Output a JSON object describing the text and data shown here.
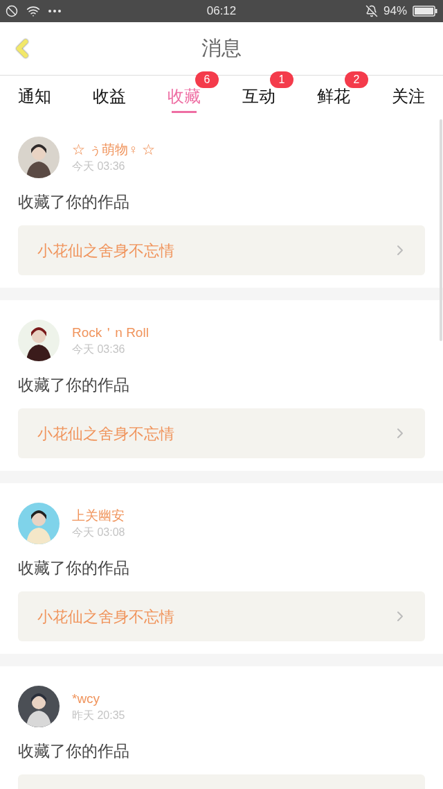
{
  "status_bar": {
    "time": "06:12",
    "battery": "94%"
  },
  "header": {
    "title": "消息"
  },
  "tabs": [
    {
      "label": "通知",
      "selected": false
    },
    {
      "label": "收益",
      "selected": false
    },
    {
      "label": "收藏",
      "selected": true,
      "badge": "6"
    },
    {
      "label": "互动",
      "selected": false,
      "badge": "1"
    },
    {
      "label": "鲜花",
      "selected": false,
      "badge": "2"
    },
    {
      "label": "关注",
      "selected": false
    }
  ],
  "items": [
    {
      "name": "☆ ぅ萌物♀ ☆",
      "time": "今天 03:36",
      "action": "收藏了你的作品",
      "work": "小花仙之舍身不忘情"
    },
    {
      "name": "Rock＇n Roll",
      "time": "今天 03:36",
      "action": "收藏了你的作品",
      "work": "小花仙之舍身不忘情"
    },
    {
      "name": "上关幽安",
      "time": "今天 03:08",
      "action": "收藏了你的作品",
      "work": "小花仙之舍身不忘情"
    },
    {
      "name": "*wcy",
      "time": "昨天 20:35",
      "action": "收藏了你的作品"
    }
  ]
}
